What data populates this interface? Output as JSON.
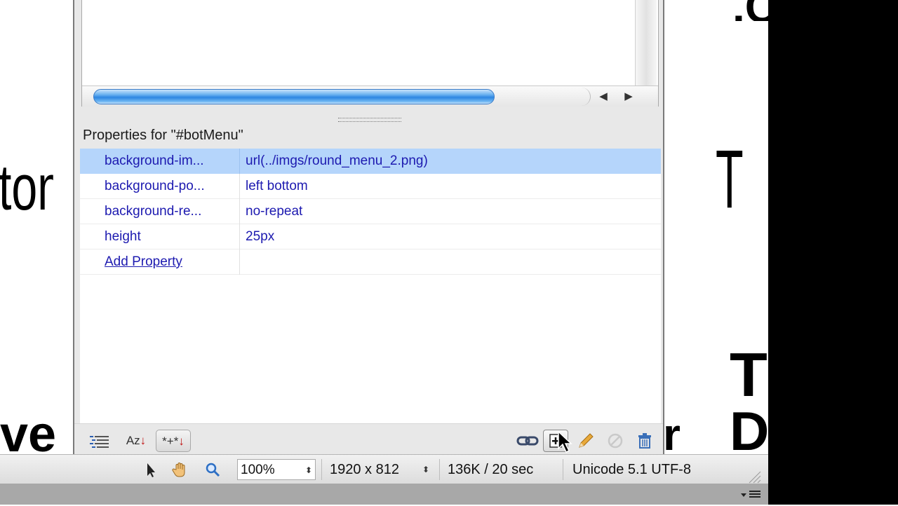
{
  "panel": {
    "properties_title": "Properties for \"#botMenu\"",
    "rows": [
      {
        "name": "background-im...",
        "value": "url(../imgs/round_menu_2.png)"
      },
      {
        "name": "background-po...",
        "value": "left bottom"
      },
      {
        "name": "background-re...",
        "value": "no-repeat"
      },
      {
        "name": "height",
        "value": "25px"
      }
    ],
    "add_property_label": "Add Property",
    "scroll_left_glyph": "◀",
    "scroll_right_glyph": "▶",
    "toolbar": {
      "show_category_icon": "list-icon",
      "az_label": "Az",
      "set_only_label": "*+*",
      "down_arrow": "↓"
    }
  },
  "status_bar": {
    "zoom": "100%",
    "dimensions": "1920 x 812",
    "download": "136K / 20 sec",
    "encoding": "Unicode 5.1 UTF-8",
    "updown_glyph": "⬍"
  },
  "background_text": {
    "left_upper": "tom",
    "left_lower": "ve",
    "right_upper": "Th",
    "right_bold_1": "T",
    "right_bold_2": "D",
    "right_top": ".C",
    "mid_r": "r"
  },
  "colors": {
    "selection": "#b5d5fb",
    "property_text": "#1d1ab0",
    "scroll_thumb": "#2d86e2"
  }
}
